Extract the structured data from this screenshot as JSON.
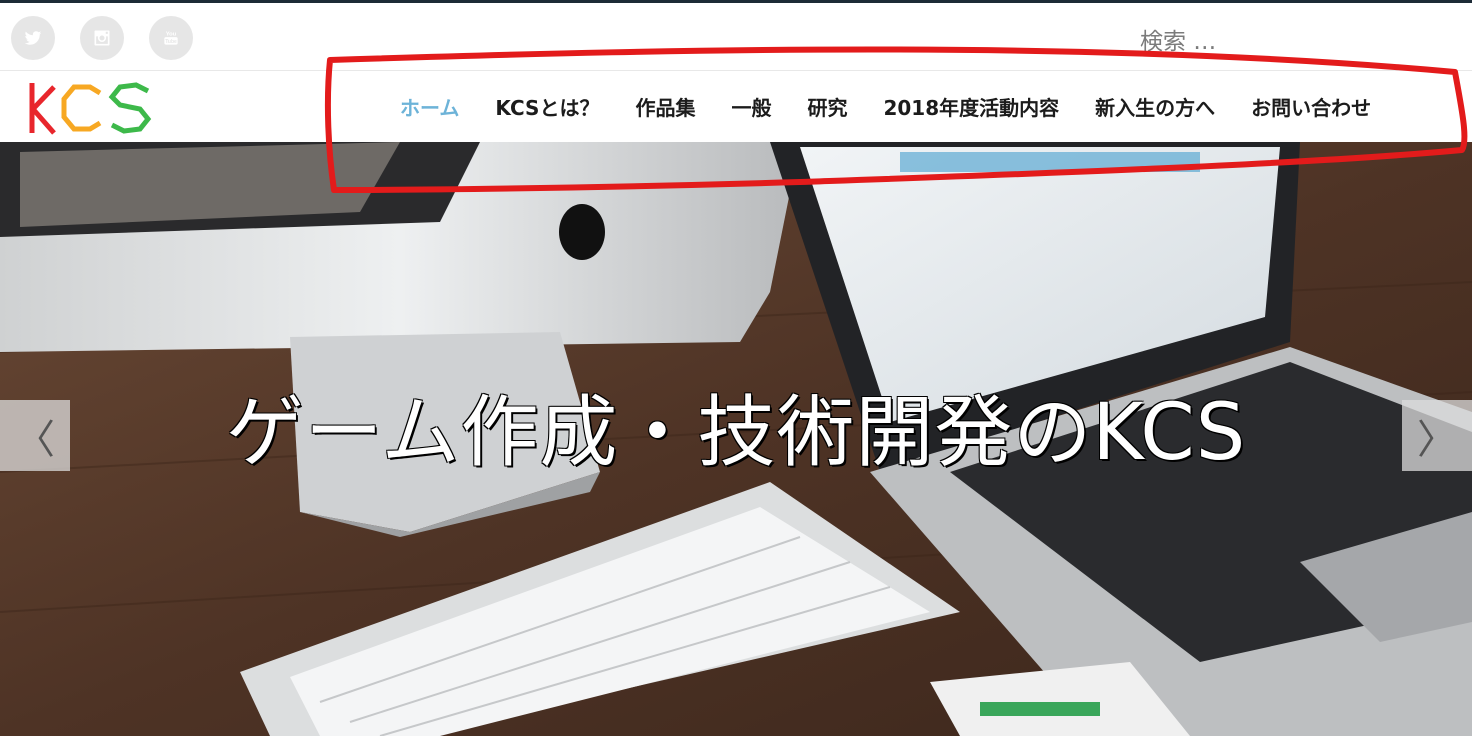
{
  "social": {
    "items": [
      {
        "name": "twitter",
        "icon": "twitter-icon"
      },
      {
        "name": "instagram",
        "icon": "instagram-icon"
      },
      {
        "name": "youtube",
        "icon": "youtube-icon",
        "label": "You Tube"
      }
    ]
  },
  "search": {
    "placeholder": "検索 …"
  },
  "logo": {
    "text": "KCS",
    "colors": [
      "#e8262c",
      "#f7a823",
      "#3db94a"
    ]
  },
  "nav": {
    "items": [
      {
        "label": "ホーム",
        "active": true
      },
      {
        "label": "KCSとは？"
      },
      {
        "label": "作品集"
      },
      {
        "label": "一般"
      },
      {
        "label": "研究"
      },
      {
        "label": "2018年度活動内容"
      },
      {
        "label": "新入生の方へ"
      },
      {
        "label": "お問い合わせ"
      }
    ]
  },
  "hero": {
    "caption": "ゲーム作成・技術開発のKCS",
    "prev_label": "〈",
    "next_label": "〉"
  },
  "colors": {
    "active_nav": "#6db3d8",
    "annotation": "#e31b1b"
  }
}
